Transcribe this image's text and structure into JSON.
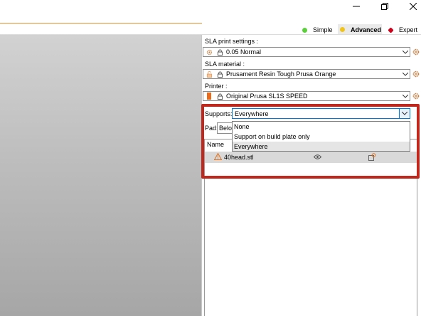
{
  "window": {
    "minimize_icon": "minimize-icon",
    "restore_icon": "restore-icon",
    "close_icon": "close-icon"
  },
  "modes": {
    "simple": {
      "label": "Simple",
      "color": "#5ccf3c"
    },
    "advanced": {
      "label": "Advanced",
      "color": "#f0c419",
      "active": true
    },
    "expert": {
      "label": "Expert",
      "color": "#d0021b"
    }
  },
  "sidebar": {
    "print_settings": {
      "label": "SLA print settings :",
      "value": "0.05 Normal"
    },
    "material": {
      "label": "SLA material :",
      "value": "Prusament Resin Tough Prusa Orange",
      "swatch": "#f7c69a"
    },
    "printer": {
      "label": "Printer :",
      "value": "Original Prusa SL1S SPEED",
      "swatch": "#ea6a1c"
    },
    "supports": {
      "label": "Supports:",
      "value": "Everywhere",
      "options": [
        "None",
        "Support on build plate only",
        "Everywhere"
      ],
      "highlighted_index": 2
    },
    "pad": {
      "label": "Pad:",
      "value": "Below object"
    },
    "object_list": {
      "column_name": "Name",
      "objects": [
        {
          "name": "40head.stl"
        }
      ]
    }
  },
  "colors": {
    "accent": "#e98a2e",
    "highlight_border": "#c1281d"
  }
}
